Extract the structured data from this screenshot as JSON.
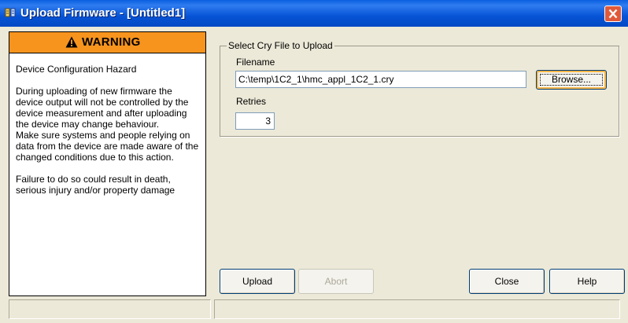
{
  "window": {
    "title": "Upload Firmware - [Untitled1]",
    "icon": "firmware-tool-icon",
    "close_icon": "close-icon",
    "titlebar_color": "#0754d6",
    "close_color": "#e05a3a"
  },
  "warning": {
    "header_icon": "warning-triangle-icon",
    "header_color": "#f7941d",
    "title": "WARNING",
    "heading": "Device Configuration Hazard",
    "paragraph1": "During uploading of new firmware the device output will not be controlled by the device measurement and after uploading the device may change behaviour.",
    "paragraph2": "Make sure systems and people relying on data from the device are made aware of the changed conditions due to this action.",
    "paragraph3": "Failure to do so could result in death, serious injury and/or property damage"
  },
  "upload_group": {
    "label": "Select Cry File to Upload",
    "filename_label": "Filename",
    "filename_value": "C:\\temp\\1C2_1\\hmc_appl_1C2_1.cry",
    "browse_label": "Browse...",
    "retries_label": "Retries",
    "retries_value": "3"
  },
  "buttons": {
    "upload": "Upload",
    "abort": "Abort",
    "close": "Close",
    "help": "Help"
  },
  "status": {
    "left": "",
    "right": ""
  }
}
